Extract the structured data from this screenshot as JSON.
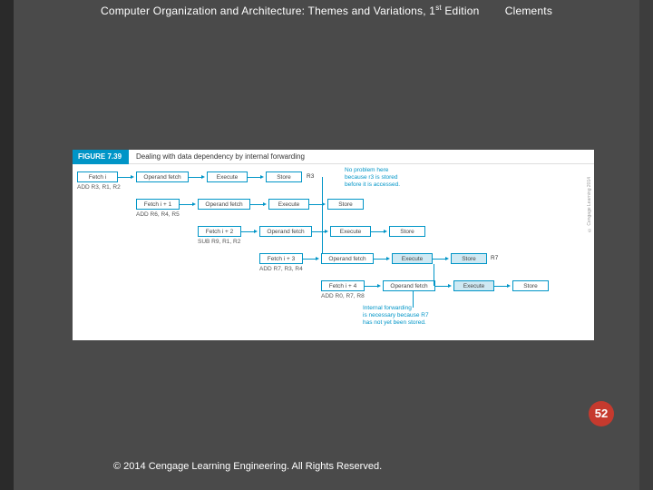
{
  "header": {
    "title_pre": "Computer Organization and Architecture: Themes and Variations, 1",
    "title_sup": "st",
    "title_post": " Edition",
    "author": "Clements"
  },
  "figure": {
    "badge": "FIGURE 7.39",
    "caption": "Dealing with data dependency by internal forwarding",
    "copyright_vert": "© Cengage Learning 2014"
  },
  "rows": [
    {
      "fetch": "Fetch i",
      "instr": "ADD  R3, R1, R2",
      "stages": [
        "Operand fetch",
        "Execute",
        "Store"
      ],
      "reg_after": "R3"
    },
    {
      "fetch": "Fetch i + 1",
      "instr": "ADD  R6, R4, R5",
      "stages": [
        "Operand fetch",
        "Execute",
        "Store"
      ]
    },
    {
      "fetch": "Fetch i + 2",
      "instr": "SUB  R9, R1, R2",
      "stages": [
        "Operand fetch",
        "Execute",
        "Store"
      ]
    },
    {
      "fetch": "Fetch i + 3",
      "instr": "ADD  R7, R3, R4",
      "stages": [
        "Operand fetch",
        "Execute",
        "Store"
      ],
      "hl": [
        1,
        2
      ],
      "reg_after": "R7"
    },
    {
      "fetch": "Fetch i + 4",
      "instr": "ADD  R0, R7, R8",
      "stages": [
        "Operand fetch",
        "Execute"
      ],
      "hl": [
        1
      ]
    }
  ],
  "notes": {
    "top": [
      "No problem here",
      "because r3 is stored",
      "before it is accessed."
    ],
    "bottom": [
      "Internal forwarding",
      "is necessary because R7",
      "has not yet been stored."
    ]
  },
  "page_number": "52",
  "footer": "© 2014 Cengage Learning Engineering. All Rights Reserved."
}
